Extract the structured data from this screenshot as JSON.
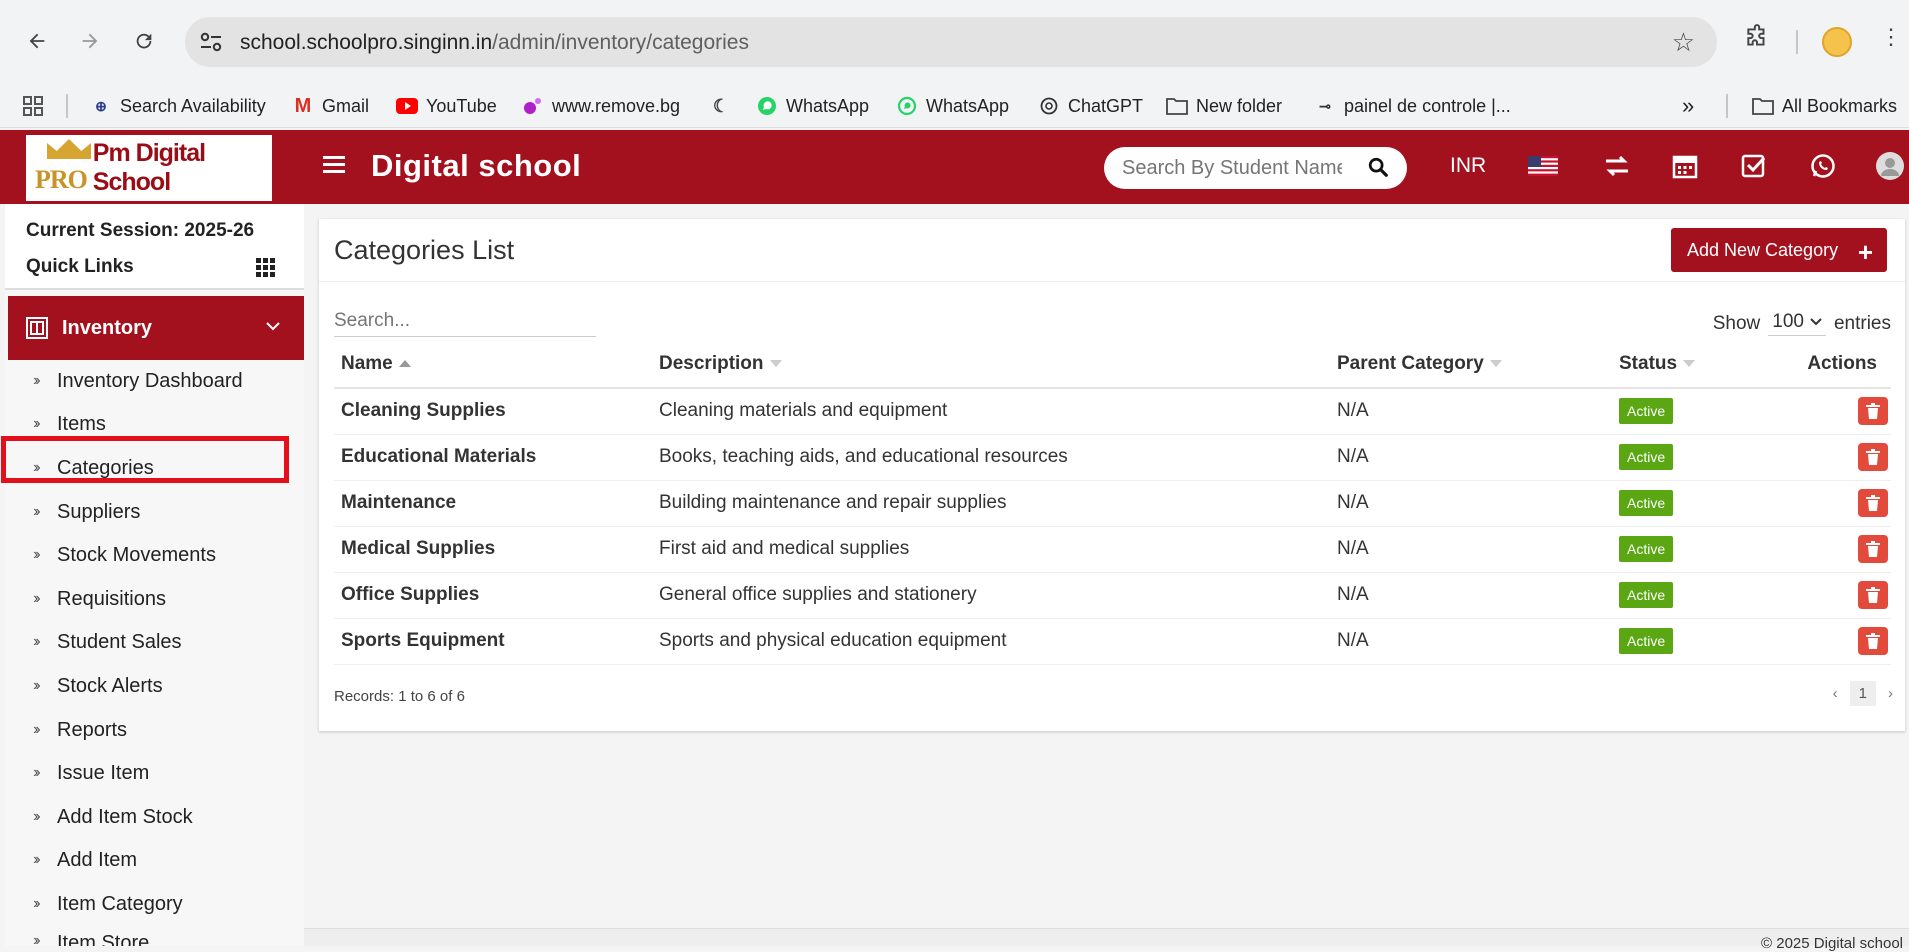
{
  "browser": {
    "url_host": "school.schoolpro.singinn.in",
    "url_path": "/admin/inventory/categories",
    "bookmarks": [
      {
        "label": "Search Availability",
        "icon": "irctc-icon"
      },
      {
        "label": "Gmail",
        "icon": "gmail-icon"
      },
      {
        "label": "YouTube",
        "icon": "youtube-icon"
      },
      {
        "label": "www.remove.bg",
        "icon": "removebg-icon"
      },
      {
        "label": "",
        "icon": "moon-icon"
      },
      {
        "label": "WhatsApp",
        "icon": "whatsapp-icon"
      },
      {
        "label": "WhatsApp",
        "icon": "whatsapp-icon"
      },
      {
        "label": "ChatGPT",
        "icon": "chatgpt-icon"
      },
      {
        "label": "New folder",
        "icon": "folder-icon"
      },
      {
        "label": "painel de controle |...",
        "icon": "key-icon"
      }
    ],
    "all_bookmarks": "All Bookmarks",
    "more": "»"
  },
  "header": {
    "logo_pro": "PRO",
    "logo_text": "Pm Digital School",
    "title": "Digital school",
    "search_placeholder": "Search By Student Name",
    "currency": "INR"
  },
  "sidebar": {
    "session": "Current Session: 2025-26",
    "quick_links": "Quick Links",
    "section": "Inventory",
    "items": [
      "Inventory Dashboard",
      "Items",
      "Categories",
      "Suppliers",
      "Stock Movements",
      "Requisitions",
      "Student Sales",
      "Stock Alerts",
      "Reports",
      "Issue Item",
      "Add Item Stock",
      "Add Item",
      "Item Category",
      "Item Store"
    ]
  },
  "main": {
    "title": "Categories List",
    "add_button": "Add New Category",
    "search_placeholder": "Search...",
    "show_label": "Show",
    "entries_value": "100",
    "entries_label": "entries",
    "columns": [
      "Name",
      "Description",
      "Parent Category",
      "Status",
      "Actions"
    ],
    "rows": [
      {
        "name": "Cleaning Supplies",
        "description": "Cleaning materials and equipment",
        "parent": "N/A",
        "status": "Active"
      },
      {
        "name": "Educational Materials",
        "description": "Books, teaching aids, and educational resources",
        "parent": "N/A",
        "status": "Active"
      },
      {
        "name": "Maintenance",
        "description": "Building maintenance and repair supplies",
        "parent": "N/A",
        "status": "Active"
      },
      {
        "name": "Medical Supplies",
        "description": "First aid and medical supplies",
        "parent": "N/A",
        "status": "Active"
      },
      {
        "name": "Office Supplies",
        "description": "General office supplies and stationery",
        "parent": "N/A",
        "status": "Active"
      },
      {
        "name": "Sports Equipment",
        "description": "Sports and physical education equipment",
        "parent": "N/A",
        "status": "Active"
      }
    ],
    "records": "Records: 1 to 6 of 6",
    "page": "1",
    "prev": "‹",
    "next": "›"
  },
  "footer": "© 2025 Digital school",
  "colors": {
    "brand": "#a4111e",
    "active": "#5aa713",
    "delete": "#e24a3b",
    "highlight": "#e3101b"
  }
}
